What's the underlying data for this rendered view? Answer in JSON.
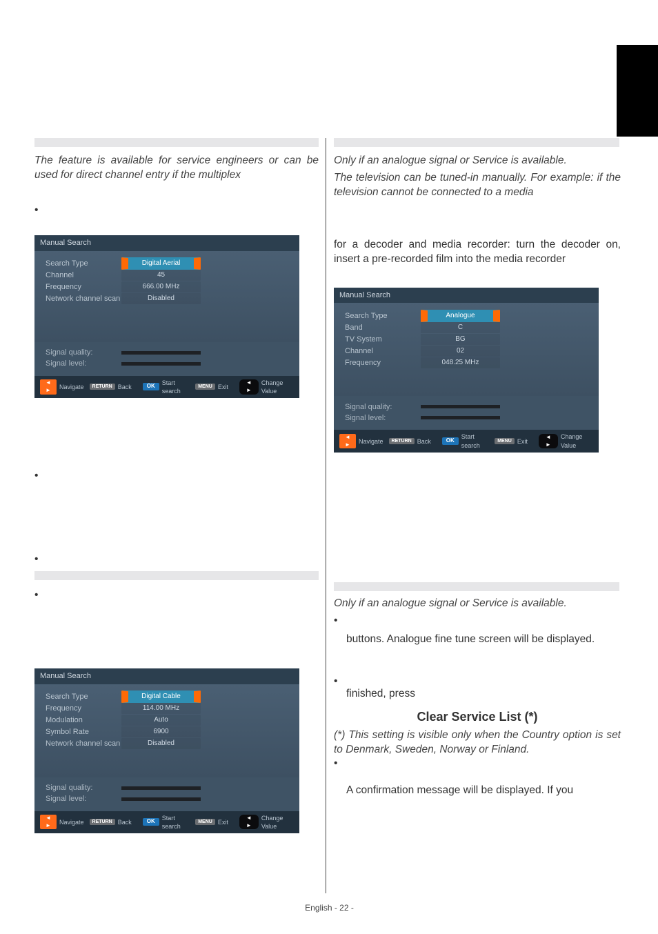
{
  "left": {
    "note1": "The feature is available for service engineers or can be used for direct channel entry if the multiplex",
    "tv_aerial": {
      "title": "Manual Search",
      "rows": [
        {
          "label": "Search Type",
          "value": "Digital Aerial",
          "pill": true
        },
        {
          "label": "Channel",
          "value": "45"
        },
        {
          "label": "Frequency",
          "value": "666.00 MHz"
        },
        {
          "label": "Network channel scan",
          "value": "Disabled"
        }
      ],
      "sig_q": "Signal quality:",
      "sig_l": "Signal level:",
      "foot": {
        "nav": "Navigate",
        "back": "Back",
        "start": "Start search",
        "exit": "Exit",
        "change": "Change Value"
      }
    },
    "tv_cable": {
      "title": "Manual Search",
      "rows": [
        {
          "label": "Search Type",
          "value": "Digital Cable",
          "pill": true
        },
        {
          "label": "Frequency",
          "value": "114.00 MHz"
        },
        {
          "label": "Modulation",
          "value": "Auto"
        },
        {
          "label": "Symbol Rate",
          "value": "6900"
        },
        {
          "label": "Network channel scan",
          "value": "Disabled"
        }
      ],
      "sig_q": "Signal quality:",
      "sig_l": "Signal level:",
      "foot": {
        "nav": "Navigate",
        "back": "Back",
        "start": "Start search",
        "exit": "Exit",
        "change": "Change Value"
      }
    }
  },
  "right": {
    "note1": "Only if an analogue signal or Service is available.",
    "para1": "The television can be tuned-in manually. For example: if the television cannot be connected to a media",
    "para2": "for a decoder and media recorder: turn the decoder on, insert a pre-recorded film into the media recorder",
    "tv_analog": {
      "title": "Manual Search",
      "rows": [
        {
          "label": "Search Type",
          "value": "Analogue",
          "pill": true
        },
        {
          "label": "Band",
          "value": "C"
        },
        {
          "label": "TV System",
          "value": "BG"
        },
        {
          "label": "Channel",
          "value": "02"
        },
        {
          "label": "Frequency",
          "value": "048.25 MHz"
        }
      ],
      "sig_q": "Signal quality:",
      "sig_l": "Signal level:",
      "foot": {
        "nav": "Navigate",
        "back": "Back",
        "start": "Start search",
        "exit": "Exit",
        "change": "Change Value"
      }
    },
    "note2": "Only if an analogue signal or Service is available.",
    "para_ft": "buttons. Analogue fine tune screen will be displayed.",
    "finished": "finished, press",
    "clear_h": "Clear Service List (*)",
    "clear_note": "(*) This setting is visible only when the Country option is set to Denmark, Sweden, Norway or Finland.",
    "confirm": "A confirmation message will be displayed. If you"
  },
  "page_number": "English   - 22 -"
}
